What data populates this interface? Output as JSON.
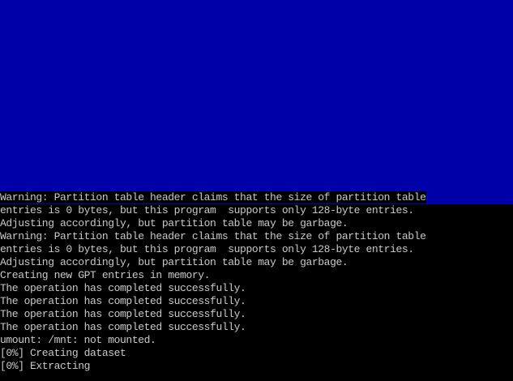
{
  "colors": {
    "upper_background": "#0000a8",
    "console_background": "#000000",
    "console_text": "#c8c8c8"
  },
  "console": {
    "lines": [
      "Warning: Partition table header claims that the size of partition table",
      "entries is 0 bytes, but this program  supports only 128-byte entries.",
      "Adjusting accordingly, but partition table may be garbage.",
      "Warning: Partition table header claims that the size of partition table",
      "entries is 0 bytes, but this program  supports only 128-byte entries.",
      "Adjusting accordingly, but partition table may be garbage.",
      "Creating new GPT entries in memory.",
      "The operation has completed successfully.",
      "The operation has completed successfully.",
      "The operation has completed successfully.",
      "The operation has completed successfully.",
      "umount: /mnt: not mounted.",
      "[0%] Creating dataset",
      "[0%] Extracting"
    ]
  }
}
